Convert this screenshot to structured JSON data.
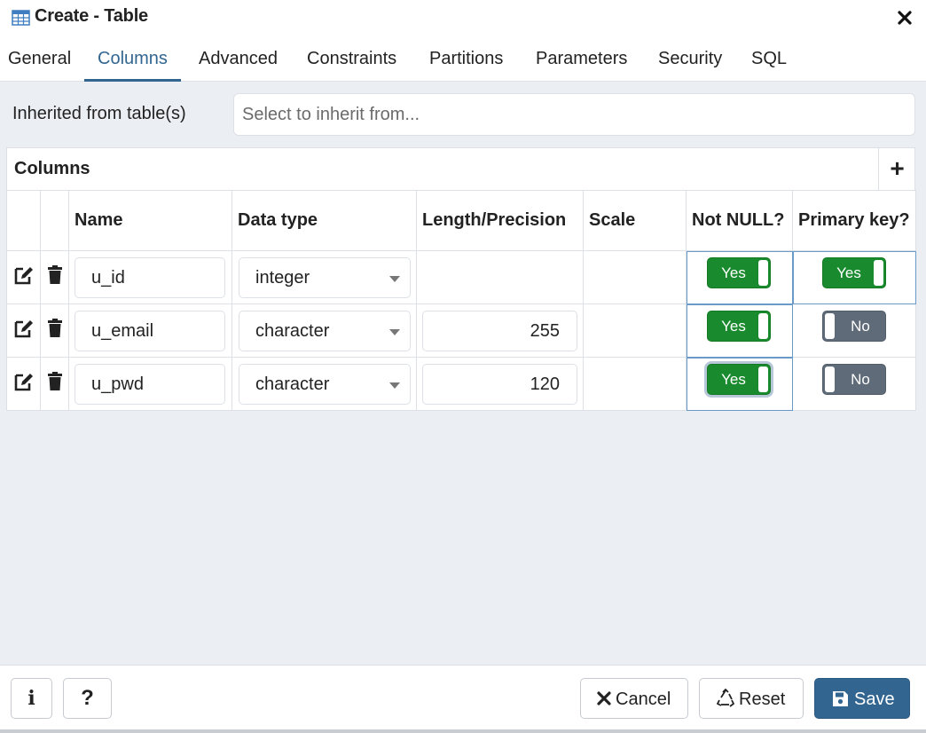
{
  "dialog": {
    "title": "Create - Table",
    "close_symbol": "✕"
  },
  "tabs": [
    {
      "label": "General",
      "active": false
    },
    {
      "label": "Columns",
      "active": true
    },
    {
      "label": "Advanced",
      "active": false
    },
    {
      "label": "Constraints",
      "active": false
    },
    {
      "label": "Partitions",
      "active": false
    },
    {
      "label": "Parameters",
      "active": false
    },
    {
      "label": "Security",
      "active": false
    },
    {
      "label": "SQL",
      "active": false
    }
  ],
  "inherit": {
    "label": "Inherited from table(s)",
    "placeholder": "Select to inherit from..."
  },
  "columns_grid": {
    "title": "Columns",
    "add_symbol": "+",
    "headers": [
      "Name",
      "Data type",
      "Length/Precision",
      "Scale",
      "Not NULL?",
      "Primary key?"
    ],
    "rows": [
      {
        "name": "u_id",
        "data_type": "integer",
        "length": "",
        "scale": "",
        "not_null": "Yes",
        "primary_key": "Yes"
      },
      {
        "name": "u_email",
        "data_type": "character",
        "length": "255",
        "scale": "",
        "not_null": "Yes",
        "primary_key": "No"
      },
      {
        "name": "u_pwd",
        "data_type": "character",
        "length": "120",
        "scale": "",
        "not_null": "Yes",
        "primary_key": "No"
      }
    ]
  },
  "footer": {
    "info_symbol": "i",
    "help_symbol": "?",
    "cancel_label": "Cancel",
    "reset_label": "Reset",
    "save_label": "Save"
  },
  "colors": {
    "accent": "#326690",
    "toggle_on": "#1a8a2e",
    "toggle_off": "#5f6b79",
    "background": "#ebeef3"
  },
  "icons": {
    "title": "table-icon",
    "edit": "edit-icon",
    "delete": "trash-icon",
    "cancel": "x-icon",
    "reset": "recycle-icon",
    "save": "floppy-disk-icon"
  }
}
